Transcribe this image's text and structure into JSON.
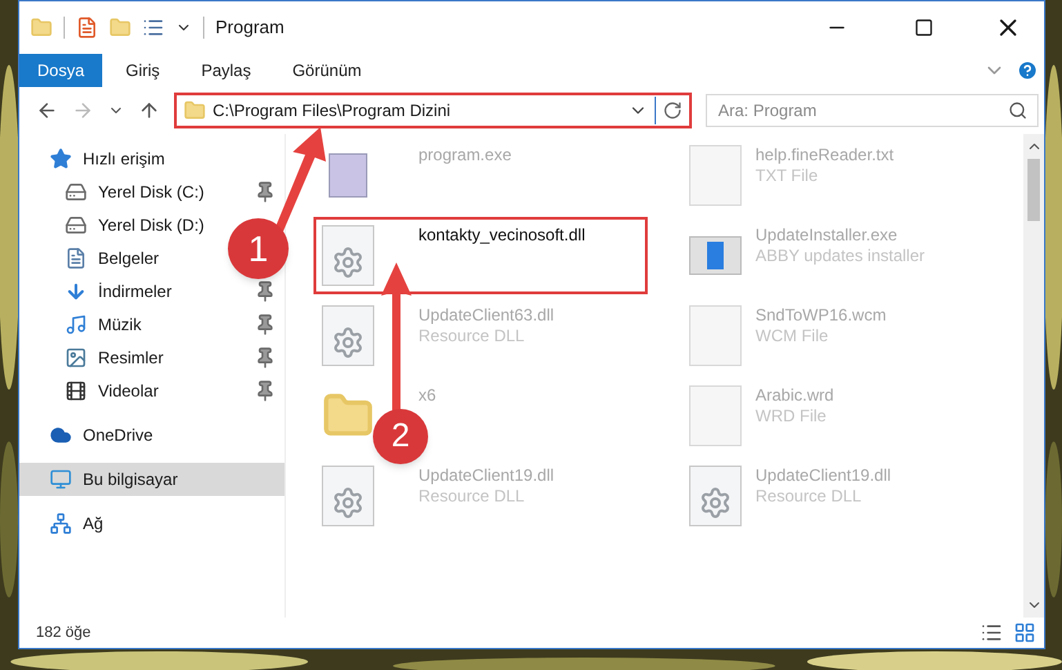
{
  "window": {
    "title": "Program"
  },
  "ribbon_tabs": [
    {
      "label": "Dosya",
      "selected": true
    },
    {
      "label": "Giriş",
      "selected": false
    },
    {
      "label": "Paylaş",
      "selected": false
    },
    {
      "label": "Görünüm",
      "selected": false
    }
  ],
  "address_bar": {
    "path": "C:\\Program Files\\Program Dizini",
    "highlighted": true
  },
  "search": {
    "placeholder": "Ara: Program"
  },
  "nav": [
    {
      "label": "Hızlı erişim",
      "kind": "star",
      "selected": false,
      "children": [
        {
          "label": "Yerel Disk (C:)",
          "kind": "drive",
          "pinned": true,
          "selected": false
        },
        {
          "label": "Yerel Disk (D:)",
          "kind": "drive",
          "selected": false
        },
        {
          "label": "Belgeler",
          "kind": "document",
          "selected": false
        },
        {
          "label": "İndirmeler",
          "kind": "download",
          "pinned": true,
          "selected": false
        },
        {
          "label": "Müzik",
          "kind": "music",
          "pinned": true,
          "selected": false
        },
        {
          "label": "Resimler",
          "kind": "pictures",
          "pinned": true,
          "selected": false
        },
        {
          "label": "Videolar",
          "kind": "video",
          "pinned": true,
          "selected": false
        }
      ]
    },
    {
      "label": "OneDrive",
      "kind": "cloud",
      "selected": false
    },
    {
      "label": "Bu bilgisayar",
      "kind": "computer",
      "selected": true
    },
    {
      "label": "Ağ",
      "kind": "network",
      "selected": false
    }
  ],
  "files": [
    {
      "name": "program.exe",
      "kind": "app",
      "highlighted": false
    },
    {
      "name": "help.fineReader.txt",
      "type": "TXT File",
      "kind": "blank",
      "highlighted": false
    },
    {
      "name": "kontakty_vecinosoft.dll",
      "kind": "gear",
      "highlighted": true
    },
    {
      "name": "UpdateInstaller.exe",
      "type": "ABBY updates installer",
      "kind": "installer",
      "highlighted": false
    },
    {
      "name": "UpdateClient63.dll",
      "type": "Resource DLL",
      "kind": "gear",
      "highlighted": false
    },
    {
      "name": "SndToWP16.wcm",
      "type": "WCM File",
      "kind": "blank",
      "highlighted": false
    },
    {
      "name": "x6",
      "kind": "folder",
      "highlighted": false
    },
    {
      "name": "Arabic.wrd",
      "type": "WRD File",
      "kind": "blank",
      "highlighted": false
    },
    {
      "name": "UpdateClient19.dll",
      "type": "Resource DLL",
      "kind": "gear",
      "highlighted": false
    },
    {
      "name": "UpdateClient19.dll",
      "type": "Resource DLL",
      "kind": "gear",
      "highlighted": false
    }
  ],
  "status_bar": {
    "count": "182 öğe"
  },
  "annotations": [
    {
      "number": "1"
    },
    {
      "number": "2"
    }
  ]
}
